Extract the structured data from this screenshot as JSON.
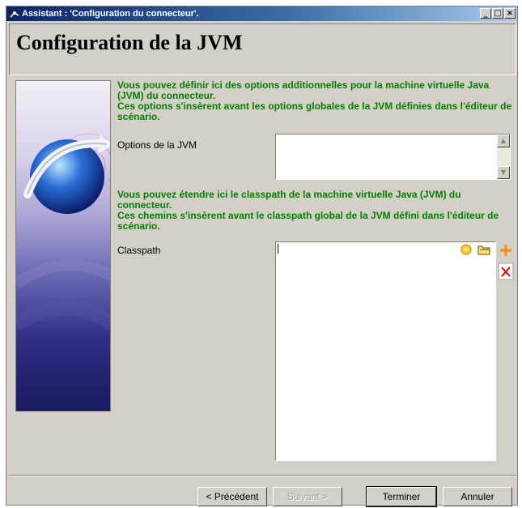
{
  "window": {
    "title": "Assistant : 'Configuration du connecteur'.",
    "controls": {
      "minimize": "_",
      "maximize": "□",
      "close": "×"
    }
  },
  "header": {
    "title": "Configuration de la JVM"
  },
  "jvm": {
    "intro": "Vous pouvez définir ici des options additionnelles pour la machine virtuelle Java (JVM) du connecteur.\nCes options s'insèrent avant les options globales de la JVM définies dans l'éditeur de scénario.",
    "options_label": "Options de la JVM",
    "options_value": ""
  },
  "classpath": {
    "intro": "Vous pouvez étendre ici le classpath de la machine virtuelle Java (JVM) du connecteur.\nCes chemins s'insèrent avant le classpath global de la JVM défini dans l'éditeur de scénario.",
    "label": "Classpath",
    "value": ""
  },
  "footer": {
    "previous": "< Précédent",
    "next": "Suivant >",
    "finish": "Terminer",
    "cancel": "Annuler"
  },
  "colors": {
    "accent_text": "#008000",
    "title_bar": "#0a246a"
  }
}
